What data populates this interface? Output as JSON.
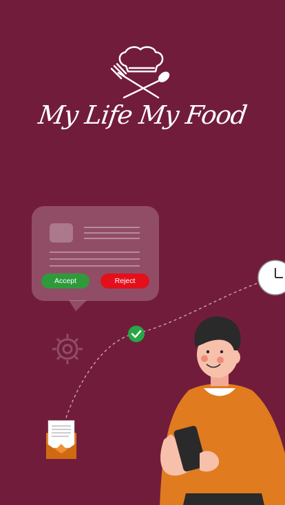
{
  "app": {
    "title": "My Life My Food"
  },
  "request_card": {
    "accept_label": "Accept",
    "reject_label": "Reject"
  },
  "icons": [
    "chef-hat-icon",
    "fork-icon",
    "spoon-icon",
    "check-icon",
    "gear-icon",
    "clock-icon",
    "envelope-document-icon"
  ],
  "colors": {
    "background": "#721c3b",
    "accept": "#2e9a3b",
    "reject": "#e3101c",
    "shirt": "#e07b1f"
  }
}
